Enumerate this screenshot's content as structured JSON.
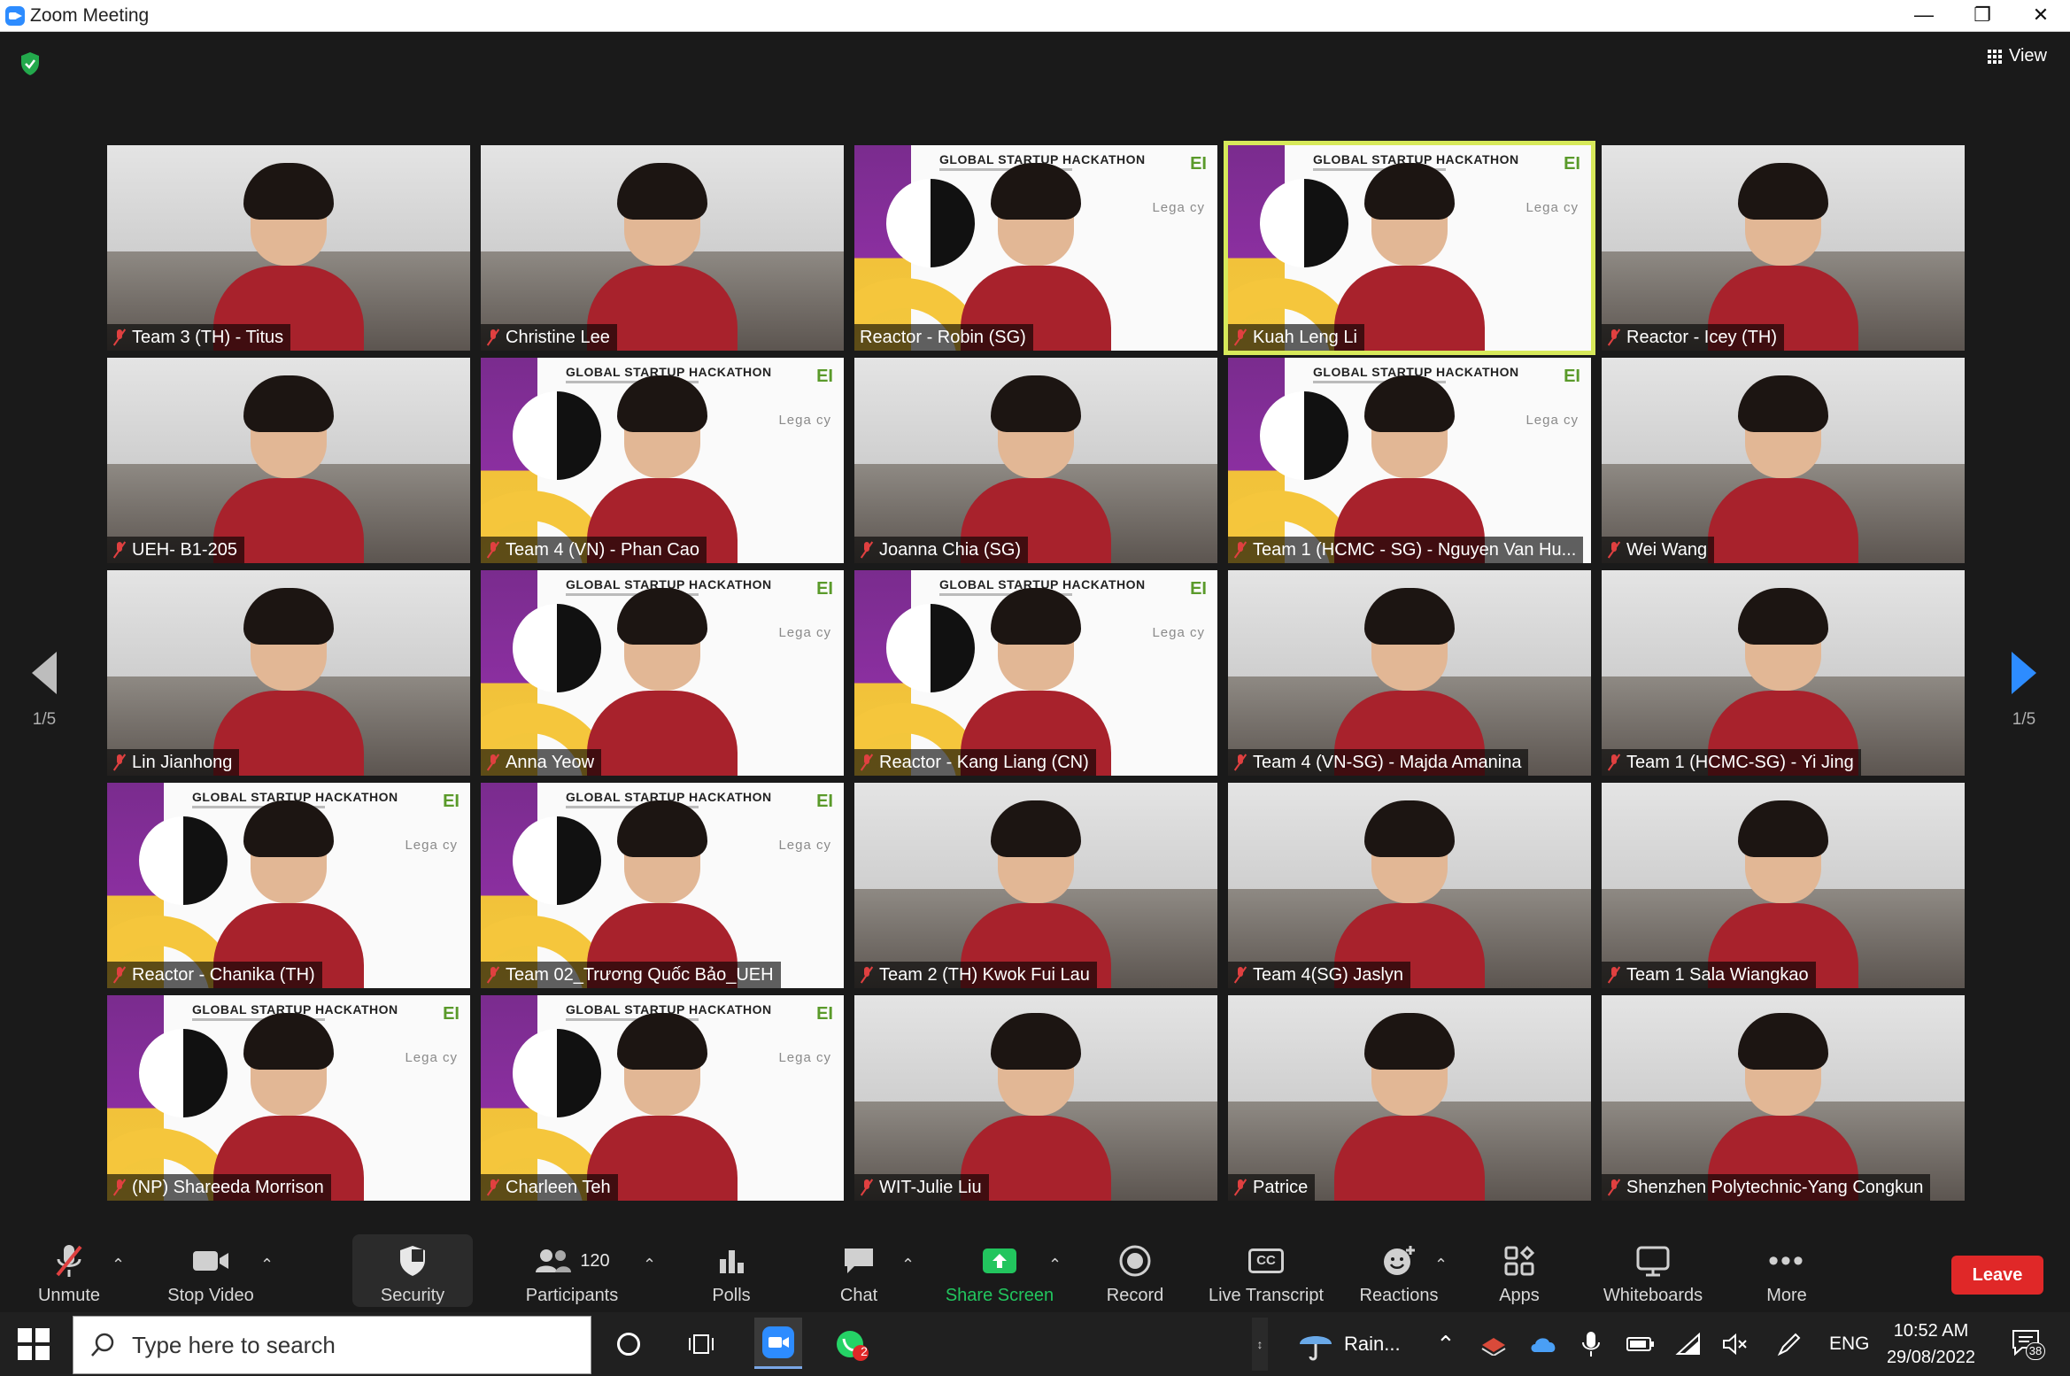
{
  "window": {
    "title": "Zoom Meeting",
    "controls": [
      "minimize",
      "restore",
      "close"
    ]
  },
  "header": {
    "view_label": "View"
  },
  "pagination": {
    "left": "1/5",
    "right": "1/5"
  },
  "participants_grid": [
    {
      "name": "Team 3 (TH) - Titus",
      "background": "camera",
      "muted": true
    },
    {
      "name": "Christine Lee",
      "background": "camera",
      "muted": true
    },
    {
      "name": "Reactor - Robin (SG)",
      "background": "branded",
      "muted": false
    },
    {
      "name": "Kuah Leng Li",
      "background": "branded",
      "muted": true,
      "active_speaker": true
    },
    {
      "name": "Reactor - Icey (TH)",
      "background": "camera",
      "muted": true
    },
    {
      "name": "UEH- B1-205",
      "background": "camera",
      "muted": true
    },
    {
      "name": "Team 4 (VN) - Phan Cao",
      "background": "branded",
      "muted": true
    },
    {
      "name": "Joanna Chia (SG)",
      "background": "camera",
      "muted": true
    },
    {
      "name": "Team 1 (HCMC - SG) - Nguyen Van Hu...",
      "background": "branded",
      "muted": true
    },
    {
      "name": "Wei Wang",
      "background": "camera",
      "muted": true
    },
    {
      "name": "Lin Jianhong",
      "background": "camera",
      "muted": true
    },
    {
      "name": "Anna Yeow",
      "background": "branded",
      "muted": true
    },
    {
      "name": "Reactor - Kang Liang (CN)",
      "background": "branded",
      "muted": true
    },
    {
      "name": "Team 4 (VN-SG) - Majda Amanina",
      "background": "camera",
      "muted": true
    },
    {
      "name": "Team 1 (HCMC-SG) - Yi Jing",
      "background": "camera",
      "muted": true
    },
    {
      "name": "Reactor - Chanika (TH)",
      "background": "branded",
      "muted": true
    },
    {
      "name": "Team 02_Trương Quốc Bảo_UEH",
      "background": "branded",
      "muted": true
    },
    {
      "name": "Team 2 (TH) Kwok Fui Lau",
      "background": "camera",
      "muted": true
    },
    {
      "name": "Team 4(SG) Jaslyn",
      "background": "camera",
      "muted": true
    },
    {
      "name": "Team 1 Sala Wiangkao",
      "background": "camera",
      "muted": true
    },
    {
      "name": "(NP) Shareeda Morrison",
      "background": "branded",
      "muted": true
    },
    {
      "name": "Charleen Teh",
      "background": "branded",
      "muted": true
    },
    {
      "name": "WIT-Julie Liu",
      "background": "camera",
      "muted": true
    },
    {
      "name": "Patrice",
      "background": "camera",
      "muted": true
    },
    {
      "name": "Shenzhen Polytechnic-Yang Congkun",
      "background": "camera",
      "muted": true
    }
  ],
  "virtual_background": {
    "headline": "GLOBAL STARTUP HACKATHON",
    "logo_text": "EI",
    "sponsor_text": "Lega cy"
  },
  "toolbar": {
    "unmute": "Unmute",
    "stop_video": "Stop Video",
    "security": "Security",
    "participants": "Participants",
    "participants_count": "120",
    "polls": "Polls",
    "chat": "Chat",
    "share_screen": "Share Screen",
    "record": "Record",
    "live_transcript": "Live Transcript",
    "reactions": "Reactions",
    "apps": "Apps",
    "whiteboards": "Whiteboards",
    "more": "More",
    "leave": "Leave",
    "cc_badge": "CC"
  },
  "taskbar": {
    "search_placeholder": "Type here to search",
    "weather": "Rain...",
    "language": "ENG",
    "time": "10:52 AM",
    "date": "29/08/2022",
    "whatsapp_badge": "2",
    "notification_count": "38"
  },
  "colors": {
    "meeting_bg": "#1a1a1a",
    "active_speaker_border": "#d7e95a",
    "leave_button": "#e02828",
    "share_screen_green": "#22c55e",
    "brand_purple": "#8b2fa0",
    "brand_yellow": "#f5c63c"
  }
}
